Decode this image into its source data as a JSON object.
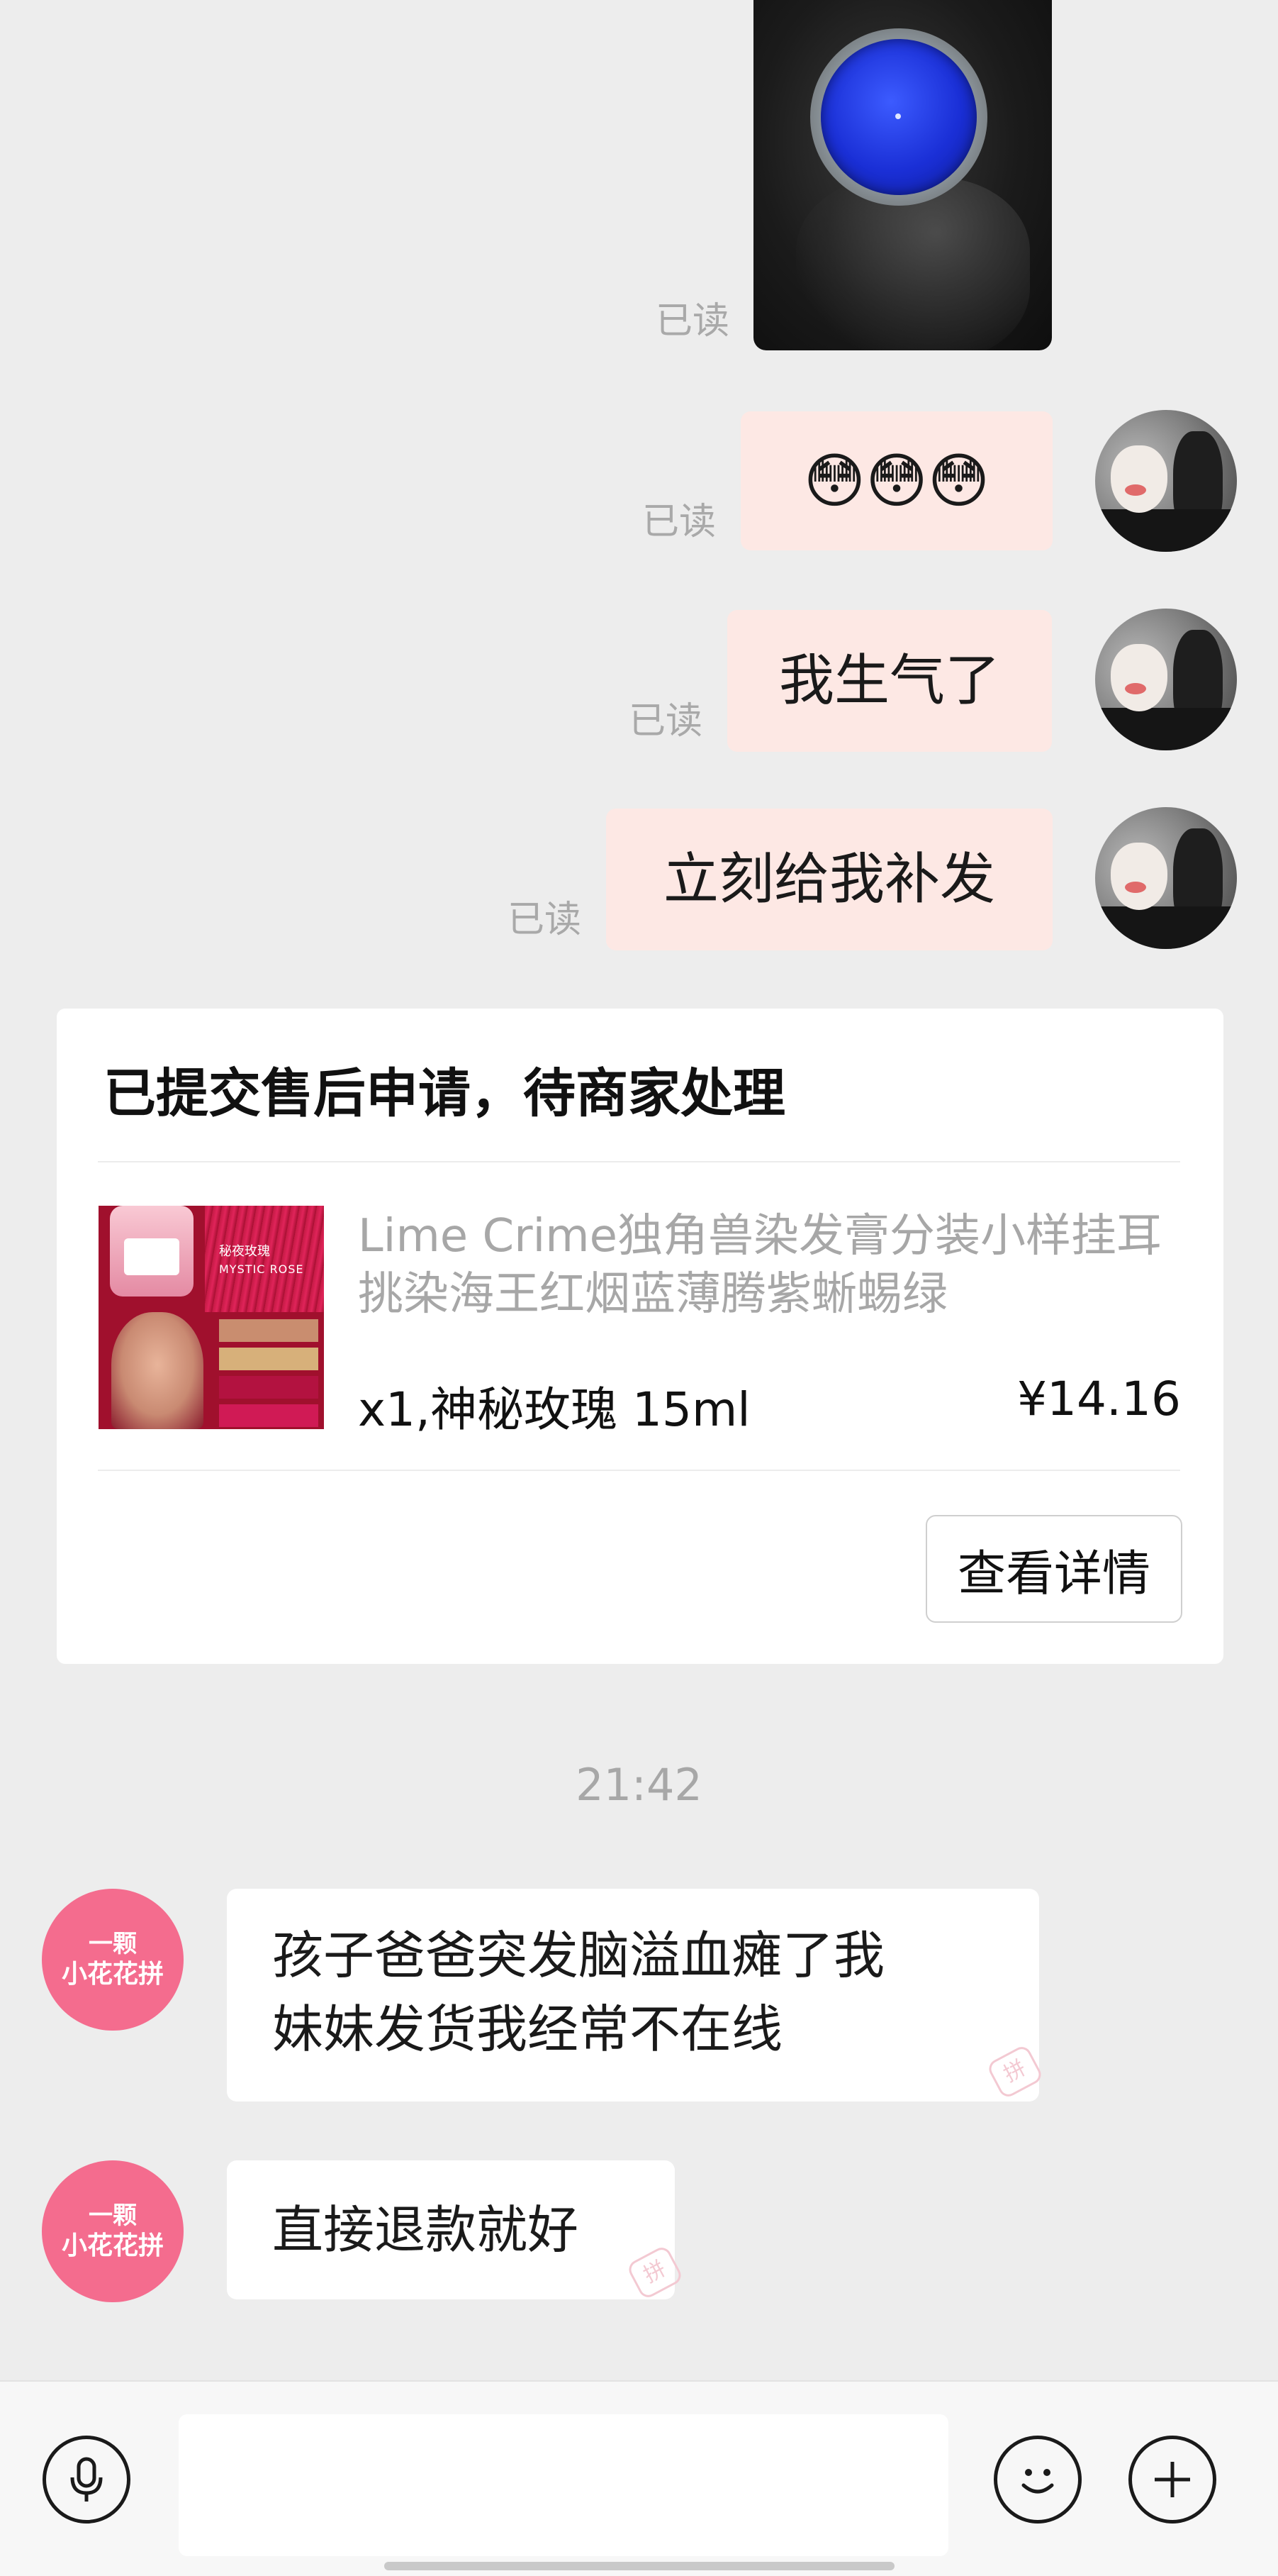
{
  "messages_out": [
    {
      "read_status": "已读"
    },
    {
      "read_status": "已读",
      "content_emoji": "😳😳😳"
    },
    {
      "read_status": "已读",
      "text": "我生气了"
    },
    {
      "read_status": "已读",
      "text": "立刻给我补发"
    }
  ],
  "order_card": {
    "title": "已提交售后申请，待商家处理",
    "product_title": "Lime Crime独角兽染发膏分装小样挂耳挑染海王红烟蓝薄腾紫蜥蜴绿",
    "spec": "x1,神秘玫瑰 15ml",
    "price": "¥14.16",
    "detail_button": "查看详情",
    "thumbnail_text_cn": "秘夜玫瑰",
    "thumbnail_text_en": "MYSTIC ROSE"
  },
  "timestamp": "21:42",
  "shop": {
    "avatar_line1": "一颗",
    "avatar_line2": "小花花拼"
  },
  "messages_in": [
    {
      "line1": "孩子爸爸突发脑溢血瘫了我",
      "line2": "妹妹发货我经常不在线"
    },
    {
      "text": "直接退款就好"
    }
  ],
  "bubble_watermark": "拼",
  "bottom_bar": {
    "icons": [
      "microphone-icon",
      "emoji-icon",
      "plus-icon"
    ]
  },
  "colors": {
    "background": "#ededed",
    "outgoing_bubble": "#fde8e4",
    "incoming_bubble": "#ffffff",
    "shop_avatar": "#f46c8e",
    "read_text": "#a9a9a9"
  }
}
